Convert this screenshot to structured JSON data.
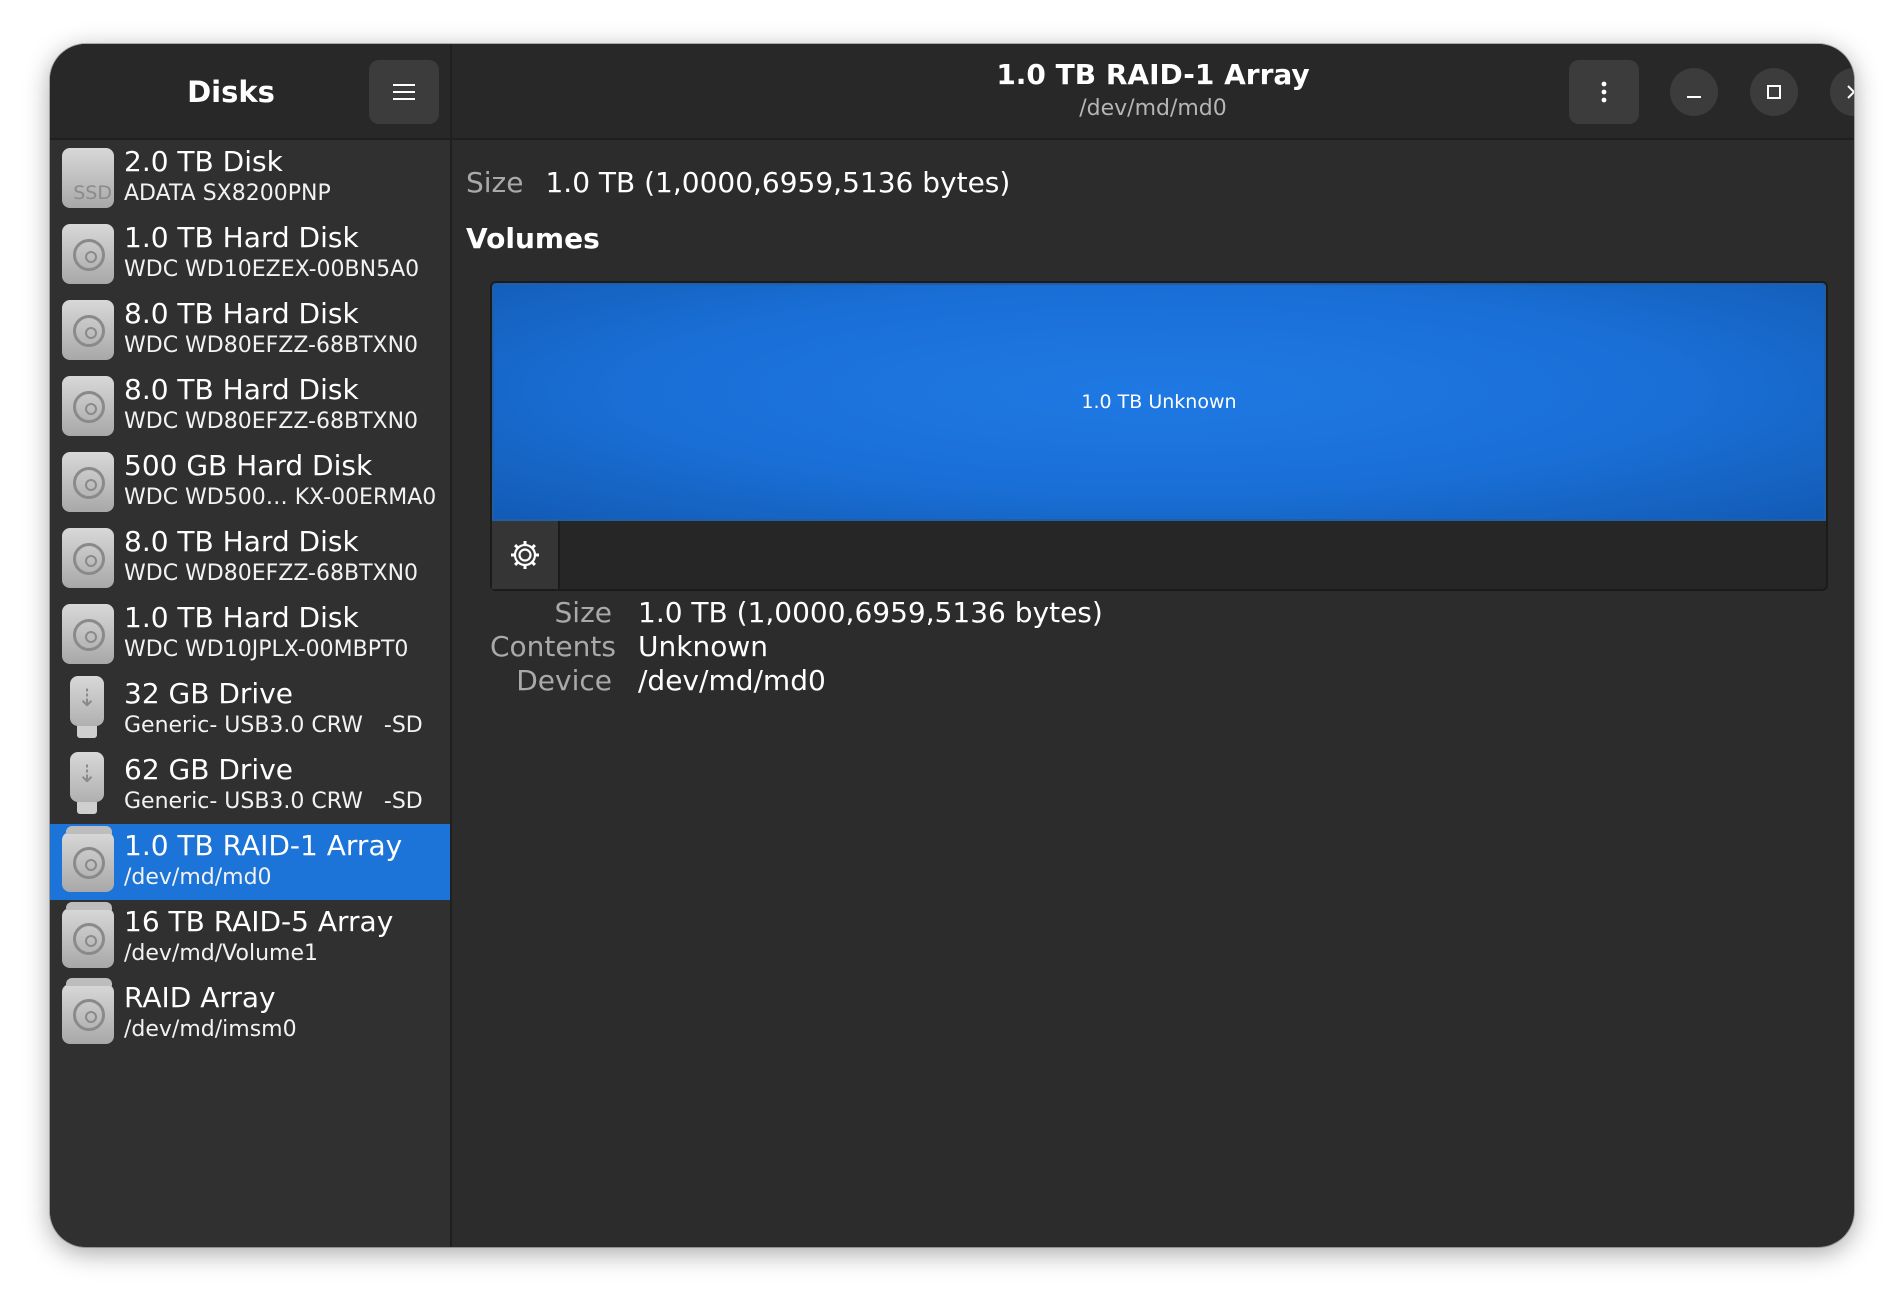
{
  "sidebar": {
    "title": "Disks",
    "items": [
      {
        "name": "2.0 TB Disk",
        "model": "ADATA SX8200PNP",
        "icon": "ssd-icon",
        "icon_text": "SSD"
      },
      {
        "name": "1.0 TB Hard Disk",
        "model": "WDC WD10EZEX-00BN5A0",
        "icon": "hard-disk-icon"
      },
      {
        "name": "8.0 TB Hard Disk",
        "model": "WDC WD80EFZZ-68BTXN0",
        "icon": "hard-disk-icon"
      },
      {
        "name": "8.0 TB Hard Disk",
        "model": "WDC WD80EFZZ-68BTXN0",
        "icon": "hard-disk-icon"
      },
      {
        "name": "500 GB Hard Disk",
        "model": "WDC WD500… KX-00ERMA0",
        "icon": "hard-disk-icon"
      },
      {
        "name": "8.0 TB Hard Disk",
        "model": "WDC WD80EFZZ-68BTXN0",
        "icon": "hard-disk-icon"
      },
      {
        "name": "1.0 TB Hard Disk",
        "model": "WDC WD10JPLX-00MBPT0",
        "icon": "hard-disk-icon"
      },
      {
        "name": "32 GB Drive",
        "model": "Generic- USB3.0 CRW   -SD",
        "icon": "usb-drive-icon"
      },
      {
        "name": "62 GB Drive",
        "model": "Generic- USB3.0 CRW   -SD",
        "icon": "usb-drive-icon"
      },
      {
        "name": "1.0 TB RAID-1 Array",
        "model": "/dev/md/md0",
        "icon": "raid-array-icon",
        "selected": true
      },
      {
        "name": "16 TB RAID-5 Array",
        "model": "/dev/md/Volume1",
        "icon": "raid-array-icon"
      },
      {
        "name": "RAID Array",
        "model": "/dev/md/imsm0",
        "icon": "raid-array-icon"
      }
    ]
  },
  "header": {
    "title": "1.0 TB RAID-1 Array",
    "subtitle": "/dev/md/md0"
  },
  "main": {
    "size_label": "Size",
    "size_value": "1.0 TB (1,0000,6959,5136 bytes)",
    "volumes_heading": "Volumes",
    "partition_label": "1.0 TB Unknown",
    "details": [
      {
        "key": "Size",
        "value": "1.0 TB (1,0000,6959,5136 bytes)"
      },
      {
        "key": "Contents",
        "value": "Unknown"
      },
      {
        "key": "Device",
        "value": "/dev/md/md0"
      }
    ]
  },
  "colors": {
    "selection": "#1c73d8",
    "partition": "#1a6fd6",
    "window_bg": "#2c2c2c"
  }
}
